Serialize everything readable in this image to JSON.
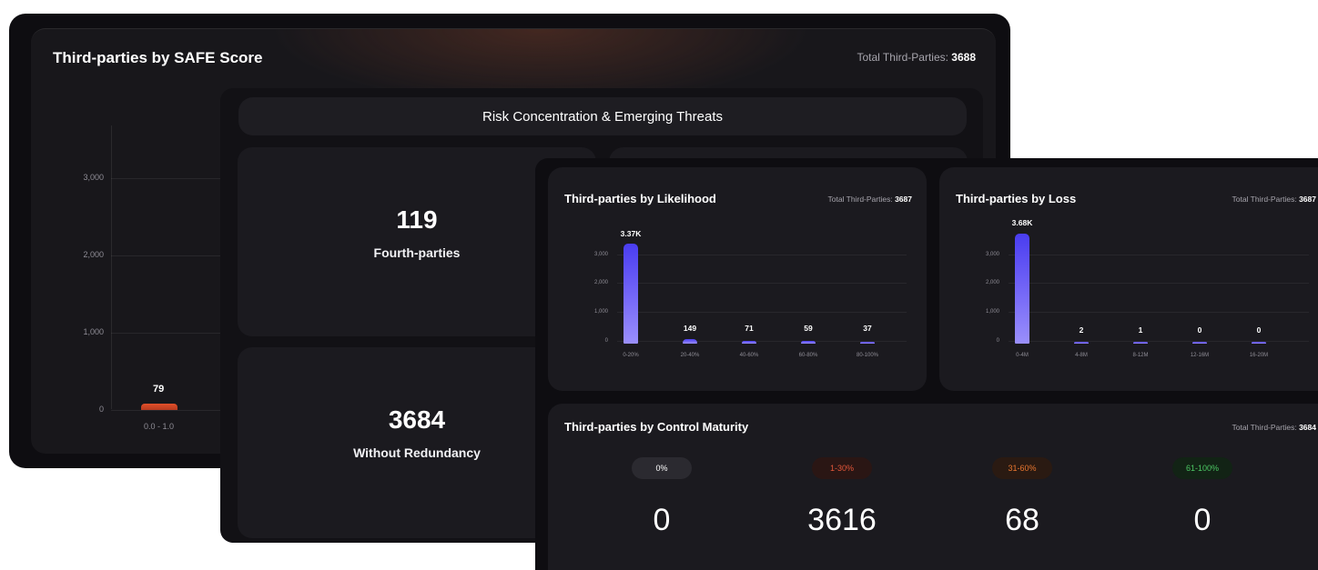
{
  "safe_panel": {
    "title": "Third-parties by SAFE Score",
    "total_label": "Total Third-Parties:",
    "total_value": "3688",
    "y_ticks": [
      "3,000",
      "2,000",
      "1,000",
      "0"
    ],
    "bar": {
      "label": "79",
      "category": "0.0 - 1.0",
      "value": 79
    },
    "bar_color": "#d9472a"
  },
  "risk_panel": {
    "header": "Risk Concentration & Emerging Threats",
    "card1": {
      "value": "119",
      "caption": "Fourth-parties"
    },
    "card2": {
      "value": "3684",
      "caption": "Without Redundancy"
    }
  },
  "likelihood_card": {
    "title": "Third-parties by Likelihood",
    "total_label": "Total Third-Parties:",
    "total_value": "3687",
    "y_ticks": [
      "3,000",
      "2,000",
      "1,000",
      "0"
    ],
    "categories": [
      "0-20%",
      "20-40%",
      "40-60%",
      "60-80%",
      "80-100%"
    ],
    "bar_labels": [
      "3.37K",
      "149",
      "71",
      "59",
      "37"
    ],
    "values": [
      3370,
      149,
      71,
      59,
      37
    ]
  },
  "loss_card": {
    "title": "Third-parties by Loss",
    "total_label": "Total Third-Parties:",
    "total_value": "3687",
    "y_ticks": [
      "3,000",
      "2,000",
      "1,000",
      "0"
    ],
    "categories": [
      "0-4M",
      "4-8M",
      "8-12M",
      "12-16M",
      "16-20M"
    ],
    "bar_labels": [
      "3.68K",
      "2",
      "1",
      "0",
      "0"
    ],
    "values": [
      3680,
      2,
      1,
      0,
      0
    ]
  },
  "maturity_card": {
    "title": "Third-parties by Control Maturity",
    "total_label": "Total Third-Parties:",
    "total_value": "3684",
    "columns": [
      {
        "pill": "0%",
        "value": "0",
        "pill_bg": "#2b2a30",
        "pill_color": "#ffffff"
      },
      {
        "pill": "1-30%",
        "value": "3616",
        "pill_bg": "#2a1614",
        "pill_color": "#e4573a"
      },
      {
        "pill": "31-60%",
        "value": "68",
        "pill_bg": "#2a1a12",
        "pill_color": "#e8762f"
      },
      {
        "pill": "61-100%",
        "value": "0",
        "pill_bg": "#122315",
        "pill_color": "#4cc764"
      }
    ]
  },
  "colors": {
    "bar_accent": "#5b4ef3",
    "background": "#0e0d11"
  }
}
